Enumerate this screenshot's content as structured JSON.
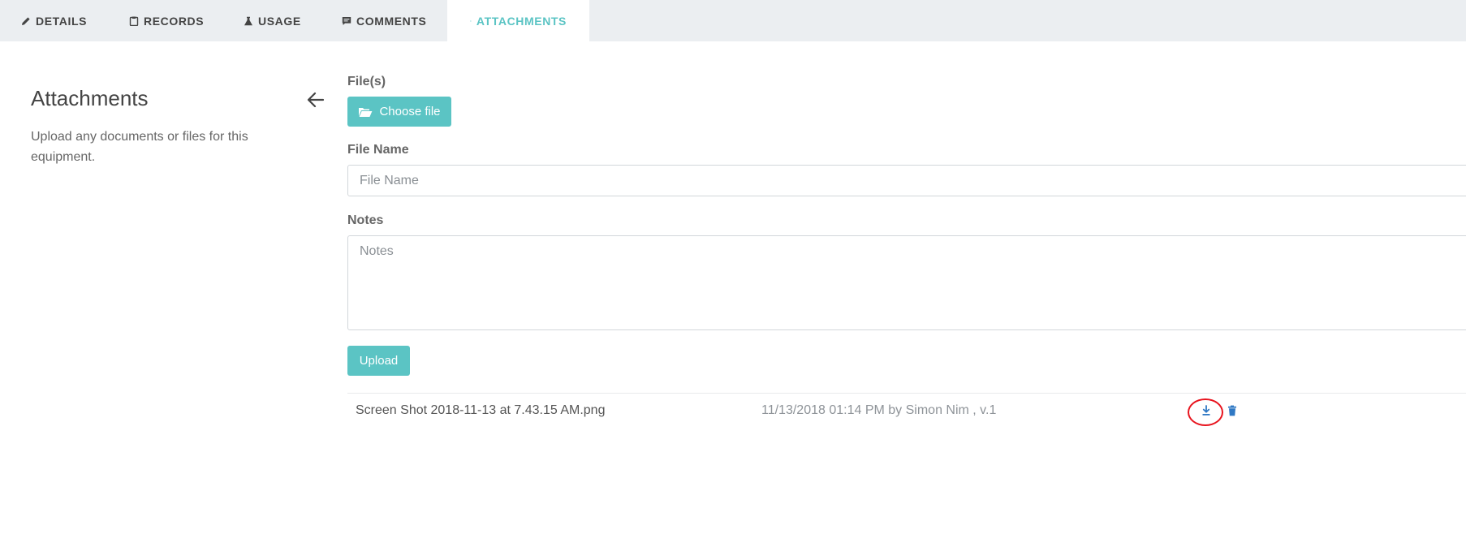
{
  "tabs": [
    {
      "label": "DETAILS",
      "icon": "pencil-icon"
    },
    {
      "label": "RECORDS",
      "icon": "clipboard-icon"
    },
    {
      "label": "USAGE",
      "icon": "flask-icon"
    },
    {
      "label": "COMMENTS",
      "icon": "comment-icon"
    },
    {
      "label": "ATTACHMENTS",
      "icon": "paperclip-icon",
      "active": true
    }
  ],
  "sidebar": {
    "title": "Attachments",
    "description": "Upload any documents or files for this equipment."
  },
  "form": {
    "files_label": "File(s)",
    "choose_file_label": "Choose file",
    "file_name_label": "File Name",
    "file_name_placeholder": "File Name",
    "notes_label": "Notes",
    "notes_placeholder": "Notes",
    "upload_label": "Upload"
  },
  "attachments": [
    {
      "name": "Screen Shot 2018-11-13 at 7.43.15 AM.png",
      "meta": "11/13/2018 01:14 PM by Simon Nim , v.1"
    }
  ],
  "colors": {
    "accent": "#5bc4c4",
    "tabbar_bg": "#ebeef1",
    "action_icon": "#2f78c4",
    "highlight": "#e8141e"
  }
}
